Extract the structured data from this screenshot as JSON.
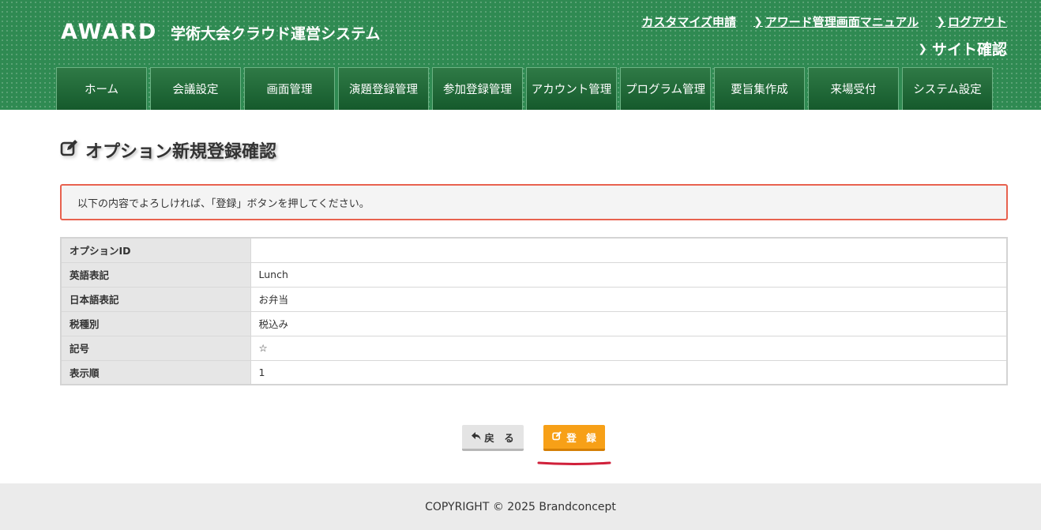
{
  "header": {
    "logo": "AWARD",
    "system_title": "学術大会クラウド運営システム",
    "links": [
      {
        "label": "カスタマイズ申請",
        "chevron": false
      },
      {
        "label": "アワード管理画面マニュアル",
        "chevron": true
      },
      {
        "label": "ログアウト",
        "chevron": true
      }
    ],
    "site_confirm": "サイト確認",
    "nav": [
      "ホーム",
      "会議設定",
      "画面管理",
      "演題登録管理",
      "参加登録管理",
      "アカウント管理",
      "プログラム管理",
      "要旨集作成",
      "来場受付",
      "システム設定"
    ]
  },
  "page": {
    "title": "オプション新規登録確認",
    "notice": "以下の内容でよろしければ、「登録」ボタンを押してください。"
  },
  "table": {
    "rows": [
      {
        "label": "オプションID",
        "value": ""
      },
      {
        "label": "英語表記",
        "value": "Lunch"
      },
      {
        "label": "日本語表記",
        "value": "お弁当"
      },
      {
        "label": "税種別",
        "value": "税込み"
      },
      {
        "label": "記号",
        "value": "☆"
      },
      {
        "label": "表示順",
        "value": "1"
      }
    ]
  },
  "buttons": {
    "back": "戻　る",
    "register": "登　録"
  },
  "footer": {
    "copyright": "COPYRIGHT © 2025 Brandconcept"
  },
  "colors": {
    "header_green": "#2f8a52",
    "nav_green": "#1d6b37",
    "notice_border": "#e8624f",
    "register_orange": "#f7a017",
    "annotation_red": "#d0203a"
  }
}
